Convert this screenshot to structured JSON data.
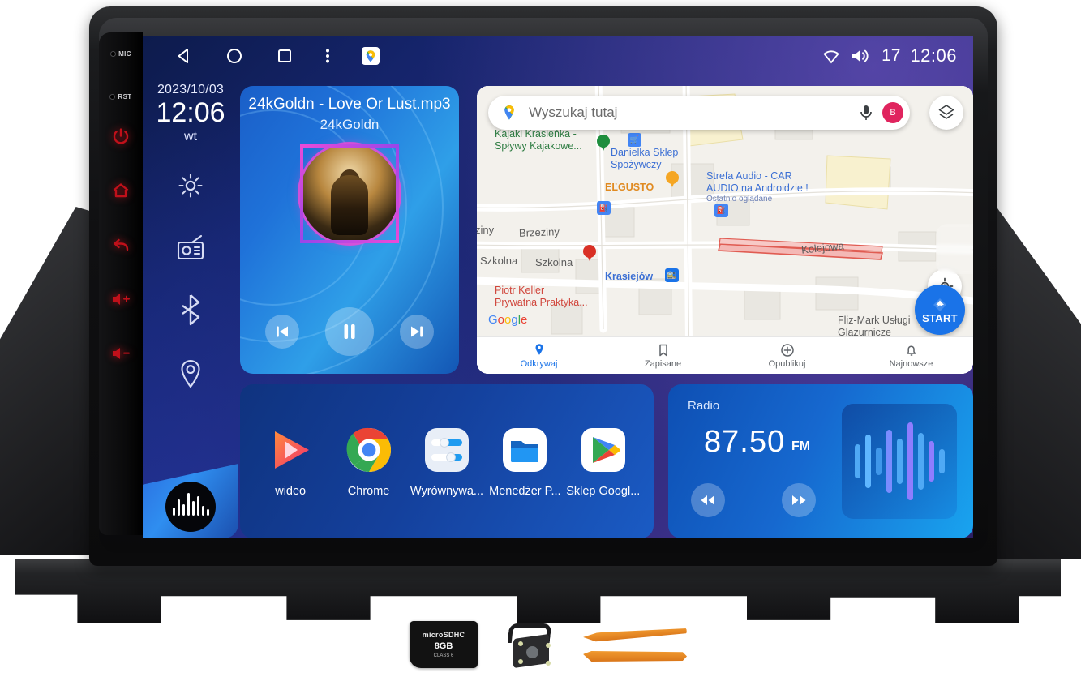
{
  "device": {
    "bezel": {
      "pins": [
        {
          "label": "MIC",
          "name": "mic-hole"
        },
        {
          "label": "RST",
          "name": "reset-hole"
        }
      ],
      "buttons": [
        {
          "name": "power-button",
          "icon": "power-icon"
        },
        {
          "name": "home-button",
          "icon": "home-icon"
        },
        {
          "name": "back-button",
          "icon": "back-arrow-icon"
        },
        {
          "name": "volume-up-button",
          "icon": "volume-up-icon"
        },
        {
          "name": "volume-down-button",
          "icon": "volume-down-icon"
        }
      ],
      "button_glow_color": "#c0101a"
    }
  },
  "statusbar": {
    "nav": [
      {
        "name": "nav-back",
        "icon": "triangle-back-icon"
      },
      {
        "name": "nav-home",
        "icon": "circle-home-icon"
      },
      {
        "name": "nav-recents",
        "icon": "square-recents-icon"
      },
      {
        "name": "nav-overflow",
        "icon": "three-dots-icon"
      },
      {
        "name": "nav-maps-shortcut",
        "icon": "google-maps-pin-icon"
      }
    ],
    "wifi_icon": "wifi-icon",
    "volume_icon": "speaker-volume-icon",
    "volume_value": "17",
    "clock": "12:06"
  },
  "dock": {
    "date": "2023/10/03",
    "time": "12:06",
    "weekday": "wt",
    "items": [
      {
        "name": "dock-settings",
        "icon": "gear-icon"
      },
      {
        "name": "dock-radio",
        "icon": "radio-icon"
      },
      {
        "name": "dock-bluetooth",
        "icon": "bluetooth-icon"
      },
      {
        "name": "dock-navigation",
        "icon": "location-pin-icon"
      }
    ],
    "badge_icon": "audio-waveform-icon"
  },
  "music": {
    "title": "24kGoldn - Love Or Lust.mp3",
    "artist": "24kGoldn",
    "album_art_alt": "album-cover",
    "controls": [
      {
        "name": "music-previous-button",
        "icon": "skip-previous-icon"
      },
      {
        "name": "music-pause-button",
        "icon": "pause-icon"
      },
      {
        "name": "music-next-button",
        "icon": "skip-next-icon"
      }
    ]
  },
  "map": {
    "search_placeholder": "Wyszukaj tutaj",
    "search_logo_icon": "google-maps-pin-icon",
    "mic_icon": "microphone-icon",
    "avatar_initial": "B",
    "layers_icon": "map-layers-icon",
    "locate_icon": "my-location-icon",
    "start_button_label": "START",
    "start_button_icon": "navigation-arrow-icon",
    "watermark": "Google",
    "pois": [
      {
        "name": "Kajaki Krasieńka -",
        "name2": "Spływy Kajakowe...",
        "color": "green"
      },
      {
        "name": "Danielka Sklep",
        "name2": "Spożywczy",
        "color": "blue"
      },
      {
        "name": "EĽGUSTO",
        "color": "orange"
      },
      {
        "name": "Strefa Audio - CAR",
        "name2": "AUDIO na Androidzie !",
        "sub": "Ostatnio oglądane",
        "color": "blue"
      },
      {
        "name": "Piotr Keller",
        "name2": "Prywatna Praktyka...",
        "color": "red"
      },
      {
        "name": "Fliz-Mark Usługi",
        "name2": "Glazurnicze",
        "color": "gray"
      },
      {
        "name": "Krasiejów",
        "color": "blue"
      }
    ],
    "streets": [
      "ziny",
      "Brzeziny",
      "Szkolna",
      "Szkolna",
      "Kolejowa"
    ],
    "bottom_nav": [
      {
        "label": "Odkrywaj",
        "icon": "explore-pin-icon",
        "active": true
      },
      {
        "label": "Zapisane",
        "icon": "bookmark-icon",
        "active": false
      },
      {
        "label": "Opublikuj",
        "icon": "plus-circle-icon",
        "active": false
      },
      {
        "label": "Najnowsze",
        "icon": "bell-icon",
        "active": false
      }
    ]
  },
  "apps": [
    {
      "label": "wideo",
      "icon": "video-play-icon"
    },
    {
      "label": "Chrome",
      "icon": "chrome-icon"
    },
    {
      "label": "Wyrównywa...",
      "icon": "equalizer-icon"
    },
    {
      "label": "Menedżer P...",
      "icon": "file-manager-folder-icon"
    },
    {
      "label": "Sklep Googl...",
      "icon": "google-play-icon"
    }
  ],
  "radio": {
    "label": "Radio",
    "frequency": "87.50",
    "band": "FM",
    "prev_icon": "rewind-icon",
    "next_icon": "fast-forward-icon",
    "visual_icon": "audio-bars-icon"
  },
  "accessories": [
    {
      "name": "microsd-card",
      "brand": "microSDHC",
      "size": "8GB",
      "class": "CLASS 6"
    },
    {
      "name": "reverse-camera",
      "label": ""
    },
    {
      "name": "pry-tools",
      "label": ""
    }
  ],
  "colors": {
    "accent_blue": "#1a73e8",
    "screen_bg": "#1b2470",
    "card_blue": "#1668cf",
    "button_red_glow": "#c0101a"
  }
}
